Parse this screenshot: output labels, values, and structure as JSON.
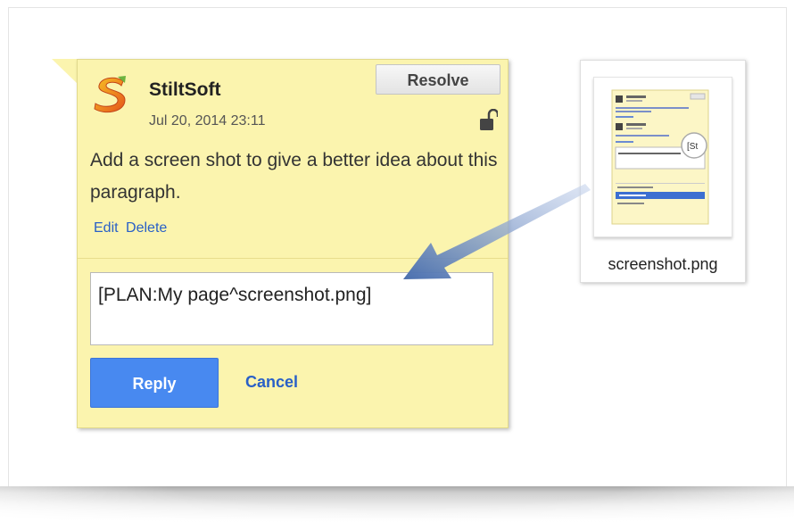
{
  "comment": {
    "author": "StiltSoft",
    "timestamp": "Jul 20, 2014 23:11",
    "resolve_label": "Resolve",
    "text": "Add a screen shot to give a better idea about this paragraph.",
    "edit_label": "Edit",
    "delete_label": "Delete",
    "reply_value": "[PLAN:My page^screenshot.png]",
    "reply_label": "Reply",
    "cancel_label": "Cancel"
  },
  "attachment": {
    "file_name": "screenshot.png",
    "icon": "image-file-icon"
  },
  "colors": {
    "comment_bg": "#fbf4ae",
    "link": "#2960c7",
    "primary_button": "#4889f0",
    "arrow": "#4a6fae"
  }
}
